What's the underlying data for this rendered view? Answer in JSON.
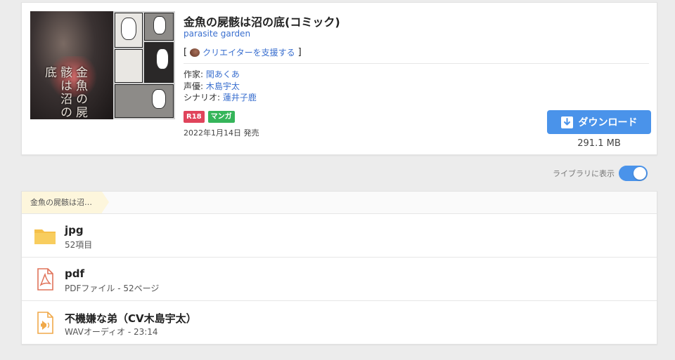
{
  "work": {
    "title": "金魚の屍骸は沼の底(コミック)",
    "circle": "parasite garden",
    "support_open": "[",
    "support_label": "クリエイターを支援する",
    "support_close": "]",
    "credits": [
      {
        "key": "作家: ",
        "value": "閏あくあ"
      },
      {
        "key": "声優: ",
        "value": "木島宇太"
      },
      {
        "key": "シナリオ: ",
        "value": "蓮井子鹿"
      }
    ],
    "tags": [
      "R18",
      "マンガ"
    ],
    "release": "2022年1月14日 発売",
    "cover_title_art": "金魚の屍骸は沼の底",
    "download_label": "ダウンロード",
    "size": "291.1 MB"
  },
  "library": {
    "label": "ライブラリに表示",
    "enabled": true
  },
  "breadcrumb": "金魚の屍骸は沼…",
  "files": [
    {
      "name": "jpg",
      "meta": "52項目",
      "icon": "folder-icon"
    },
    {
      "name": "pdf",
      "meta": "PDFファイル - 52ページ",
      "icon": "pdf-file-icon"
    },
    {
      "name": "不機嫌な弟（CV木島宇太）",
      "meta": "WAVオーディオ - 23:14",
      "icon": "audio-file-icon"
    }
  ],
  "colors": {
    "accent": "#4a93ea",
    "link": "#3a6fcf",
    "r18": "#e0445b",
    "manga": "#35b55a",
    "folder": "#f5c04a",
    "pdf": "#e0735a",
    "audio": "#f0a94a"
  }
}
